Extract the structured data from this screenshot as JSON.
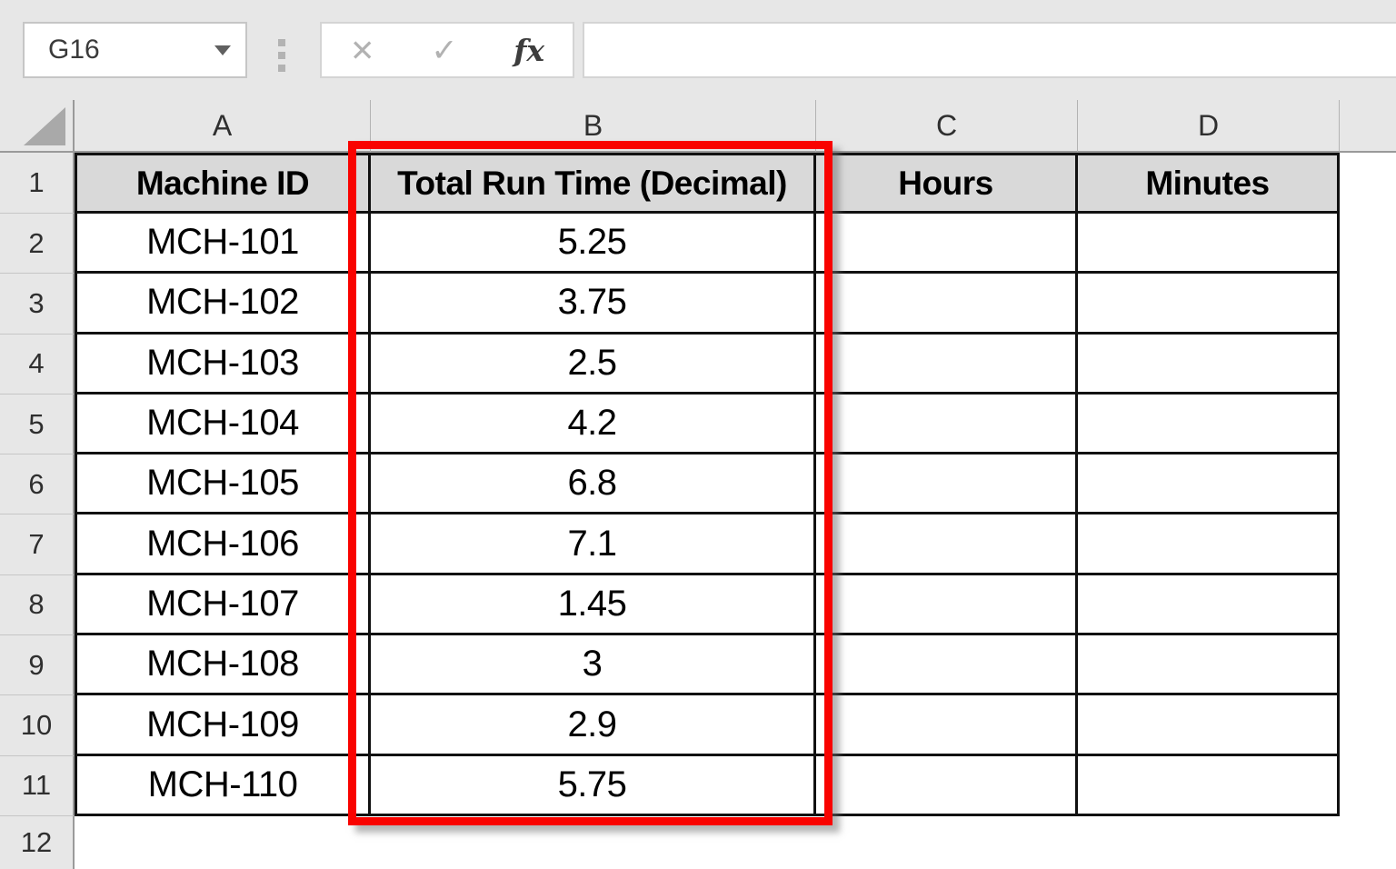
{
  "name_box": {
    "value": "G16"
  },
  "toolbar": {
    "cancel_glyph": "✕",
    "confirm_glyph": "✓",
    "function_glyph": "fx"
  },
  "formula_bar": {
    "value": ""
  },
  "sheet": {
    "column_letters": [
      "A",
      "B",
      "C",
      "D"
    ],
    "row_numbers": [
      "1",
      "2",
      "3",
      "4",
      "5",
      "6",
      "7",
      "8",
      "9",
      "10",
      "11",
      "12"
    ],
    "header_row": {
      "machine_id": "Machine ID",
      "run_time": "Total Run Time (Decimal)",
      "hours": "Hours",
      "minutes": "Minutes"
    },
    "rows": [
      {
        "machine_id": "MCH-101",
        "run_time": "5.25",
        "hours": "",
        "minutes": ""
      },
      {
        "machine_id": "MCH-102",
        "run_time": "3.75",
        "hours": "",
        "minutes": ""
      },
      {
        "machine_id": "MCH-103",
        "run_time": "2.5",
        "hours": "",
        "minutes": ""
      },
      {
        "machine_id": "MCH-104",
        "run_time": "4.2",
        "hours": "",
        "minutes": ""
      },
      {
        "machine_id": "MCH-105",
        "run_time": "6.8",
        "hours": "",
        "minutes": ""
      },
      {
        "machine_id": "MCH-106",
        "run_time": "7.1",
        "hours": "",
        "minutes": ""
      },
      {
        "machine_id": "MCH-107",
        "run_time": "1.45",
        "hours": "",
        "minutes": ""
      },
      {
        "machine_id": "MCH-108",
        "run_time": "3",
        "hours": "",
        "minutes": ""
      },
      {
        "machine_id": "MCH-109",
        "run_time": "2.9",
        "hours": "",
        "minutes": ""
      },
      {
        "machine_id": "MCH-110",
        "run_time": "5.75",
        "hours": "",
        "minutes": ""
      }
    ]
  },
  "annotation": {
    "highlight_color": "#f90300",
    "highlighted_column": "B"
  },
  "colors": {
    "chrome_background": "#e7e7e7",
    "header_cell_fill": "#d9d9d9",
    "table_border": "#111111"
  }
}
